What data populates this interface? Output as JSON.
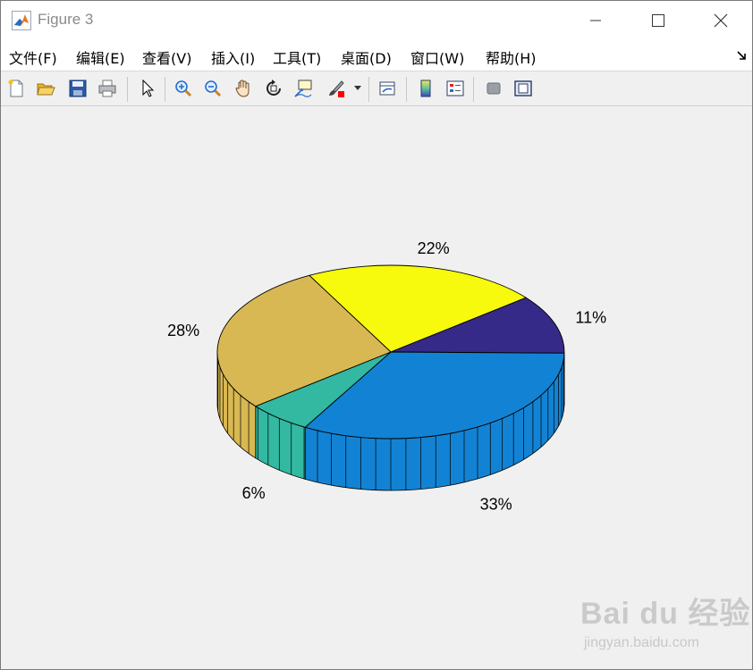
{
  "window": {
    "title": "Figure 3"
  },
  "menu": {
    "items": [
      "文件(F)",
      "编辑(E)",
      "查看(V)",
      "插入(I)",
      "工具(T)",
      "桌面(D)",
      "窗口(W)",
      "帮助(H)"
    ]
  },
  "toolbar": {
    "buttons": [
      "new-figure",
      "open-file",
      "save",
      "print",
      "edit-plot-arrow",
      "zoom-in",
      "zoom-out",
      "pan",
      "rotate-3d",
      "data-cursor",
      "brush",
      "link-plot",
      "insert-colorbar",
      "insert-legend",
      "hide-plot-tools",
      "show-plot-tools"
    ]
  },
  "chart_data": {
    "type": "pie",
    "style": "3d",
    "slices": [
      {
        "label": "22%",
        "value": 22,
        "color": "#f8fa0d"
      },
      {
        "label": "11%",
        "value": 11,
        "color": "#352a87"
      },
      {
        "label": "33%",
        "value": 33,
        "color": "#1283d4"
      },
      {
        "label": "6%",
        "value": 6,
        "color": "#33b8a1"
      },
      {
        "label": "28%",
        "value": 28,
        "color": "#d8b852"
      }
    ]
  },
  "watermark": {
    "logo": "Bai du 经验",
    "url": "jingyan.baidu.com"
  }
}
